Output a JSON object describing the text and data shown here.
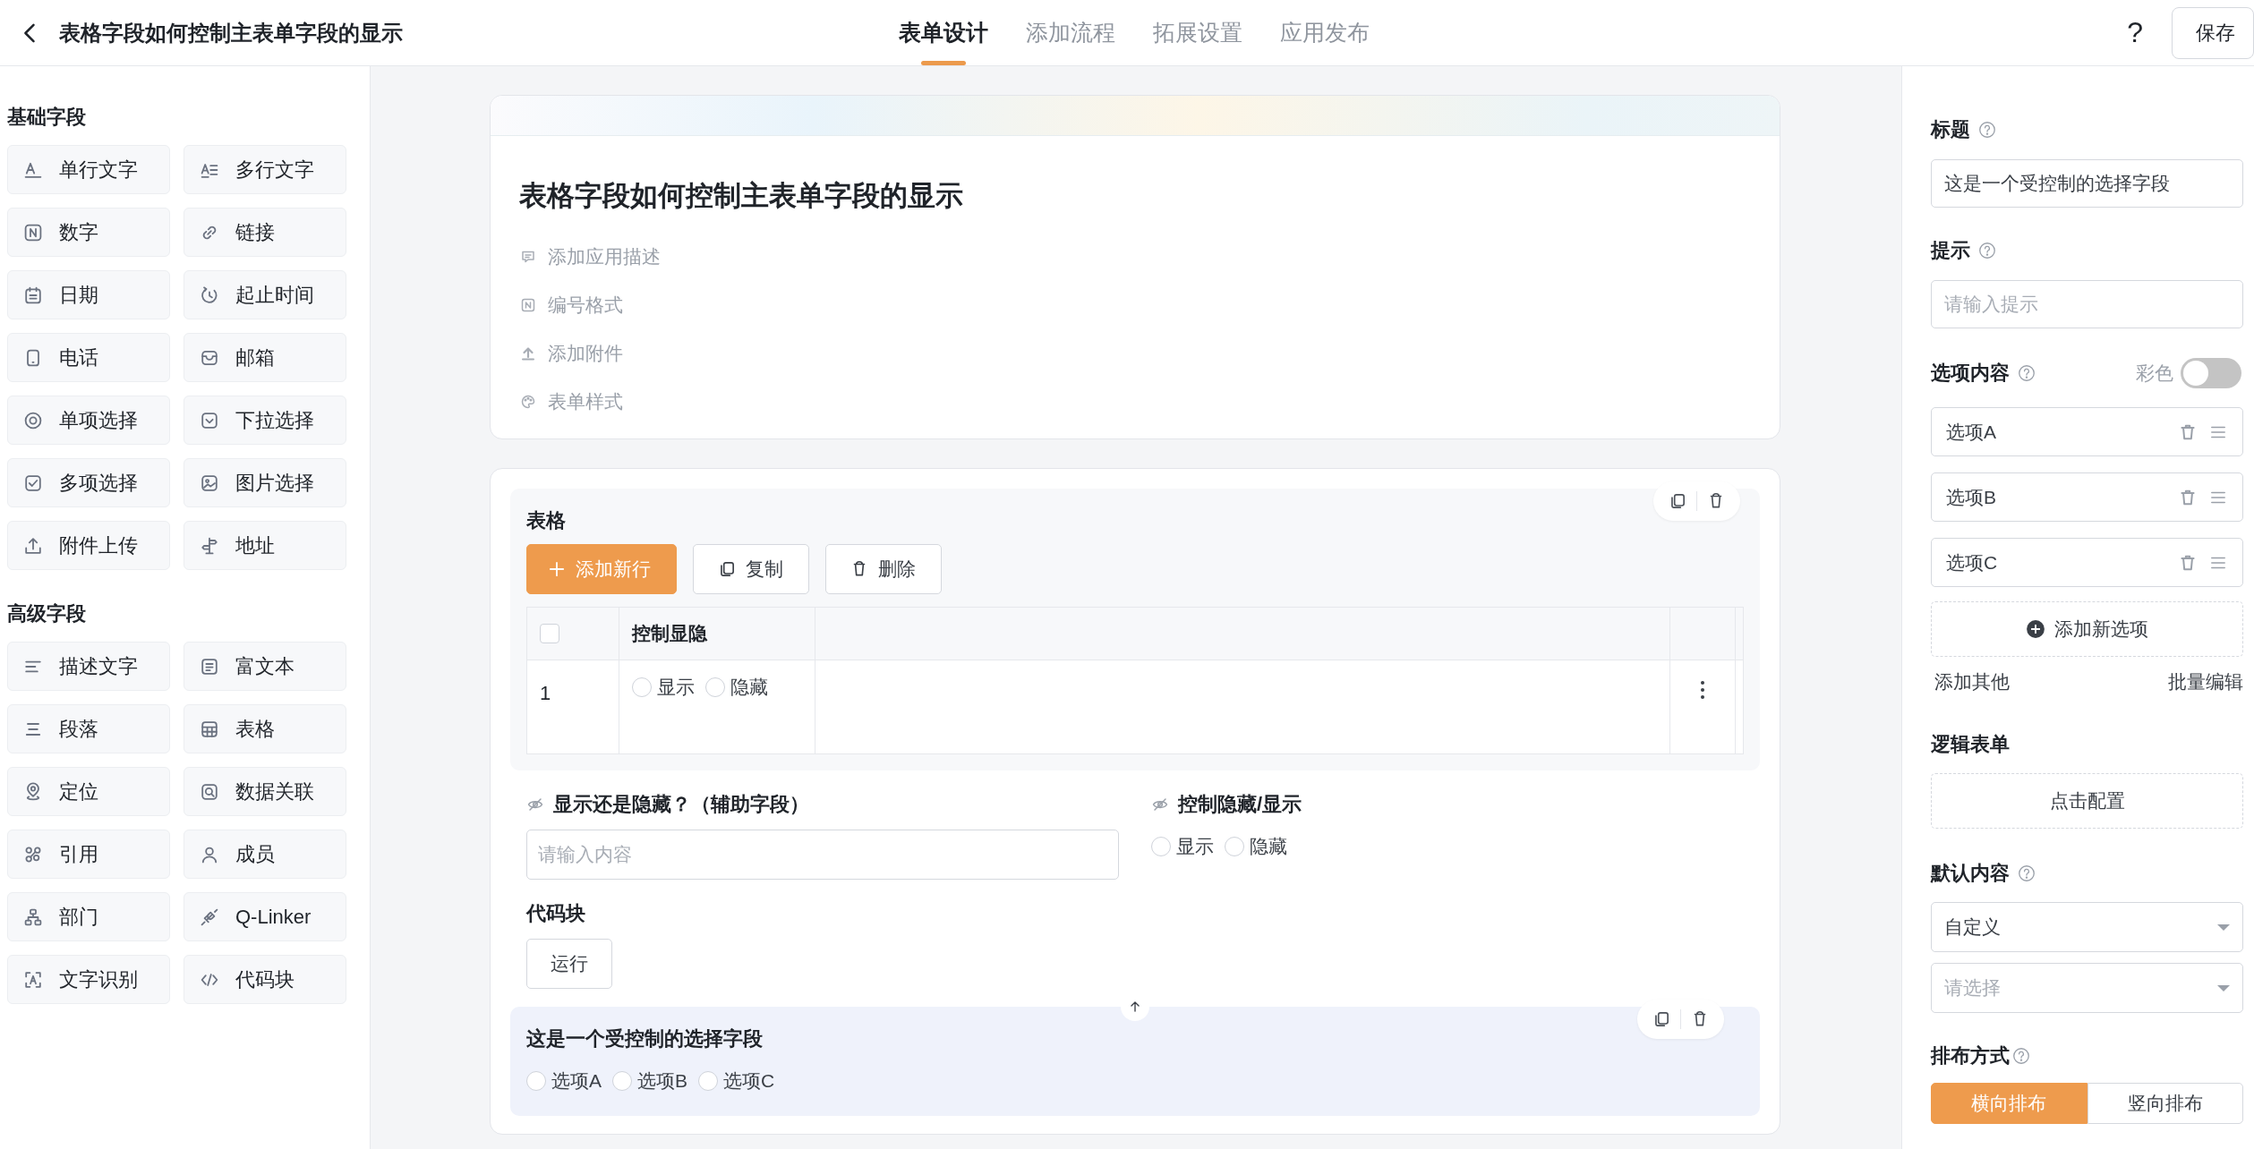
{
  "header": {
    "title": "表格字段如何控制主表单字段的显示",
    "tabs": [
      {
        "label": "表单设计",
        "selected": true
      },
      {
        "label": "添加流程",
        "selected": false
      },
      {
        "label": "拓展设置",
        "selected": false
      },
      {
        "label": "应用发布",
        "selected": false
      }
    ],
    "help": "?",
    "save": "保存"
  },
  "palette": [
    {
      "title": "基础字段",
      "items": [
        "单行文字",
        "多行文字",
        "数字",
        "链接",
        "日期",
        "起止时间",
        "电话",
        "邮箱",
        "单项选择",
        "下拉选择",
        "多项选择",
        "图片选择",
        "附件上传",
        "地址"
      ]
    },
    {
      "title": "高级字段",
      "items": [
        "描述文字",
        "富文本",
        "段落",
        "表格",
        "定位",
        "数据关联",
        "引用",
        "成员",
        "部门",
        "Q-Linker",
        "文字识别",
        "代码块"
      ]
    }
  ],
  "form": {
    "title": "表格字段如何控制主表单字段的显示",
    "meta": [
      "添加应用描述",
      "编号格式",
      "添加附件",
      "表单样式"
    ]
  },
  "table_field": {
    "label": "表格",
    "hovered": true,
    "buttons": [
      {
        "kind": "primary",
        "label": "添加新行"
      },
      {
        "kind": "copy",
        "label": "复制"
      },
      {
        "kind": "delete",
        "label": "删除"
      }
    ],
    "header_checked": false,
    "columns": [
      "控制显隐"
    ],
    "rows": [
      {
        "number": "1",
        "options": [
          {
            "label": "显示",
            "selected": false
          },
          {
            "label": "隐藏",
            "selected": false
          }
        ]
      }
    ]
  },
  "field_rows": [
    [
      {
        "kind": "text",
        "label": "显示还是隐藏？（辅助字段）",
        "hidden": true,
        "selected": false,
        "placeholder": "请输入内容"
      },
      {
        "kind": "radio",
        "label": "控制隐藏/显示",
        "hidden": true,
        "selected": false,
        "options": [
          {
            "label": "显示",
            "selected": false
          },
          {
            "label": "隐藏",
            "selected": false
          }
        ]
      }
    ],
    [
      {
        "kind": "code",
        "label": "代码块",
        "hidden": false,
        "selected": false,
        "button": "运行"
      }
    ],
    [
      {
        "kind": "radio",
        "label": "这是一个受控制的选择字段",
        "hidden": false,
        "selected": true,
        "options": [
          {
            "label": "选项A",
            "selected": false
          },
          {
            "label": "选项B",
            "selected": false
          },
          {
            "label": "选项C",
            "selected": false
          }
        ]
      }
    ]
  ],
  "properties": {
    "title": {
      "label": "标题",
      "help": true,
      "value": "这是一个受控制的选择字段"
    },
    "hint": {
      "label": "提示",
      "help": true,
      "placeholder": "请输入提示"
    },
    "options": {
      "label": "选项内容",
      "help": true,
      "colorful_label": "彩色",
      "colorful": false,
      "items": [
        "选项A",
        "选项B",
        "选项C"
      ],
      "add": "添加新选项",
      "add_other": "添加其他",
      "bulk_edit": "批量编辑"
    },
    "logic": {
      "label": "逻辑表单",
      "help": false,
      "button": "点击配置"
    },
    "default": {
      "label": "默认内容",
      "help": true,
      "value": "自定义",
      "placeholder": "请选择"
    },
    "arrangement": {
      "label": "排布方式",
      "help": true,
      "choices": [
        {
          "label": "横向排布",
          "selected": true
        },
        {
          "label": "竖向排布",
          "selected": false
        }
      ]
    }
  }
}
